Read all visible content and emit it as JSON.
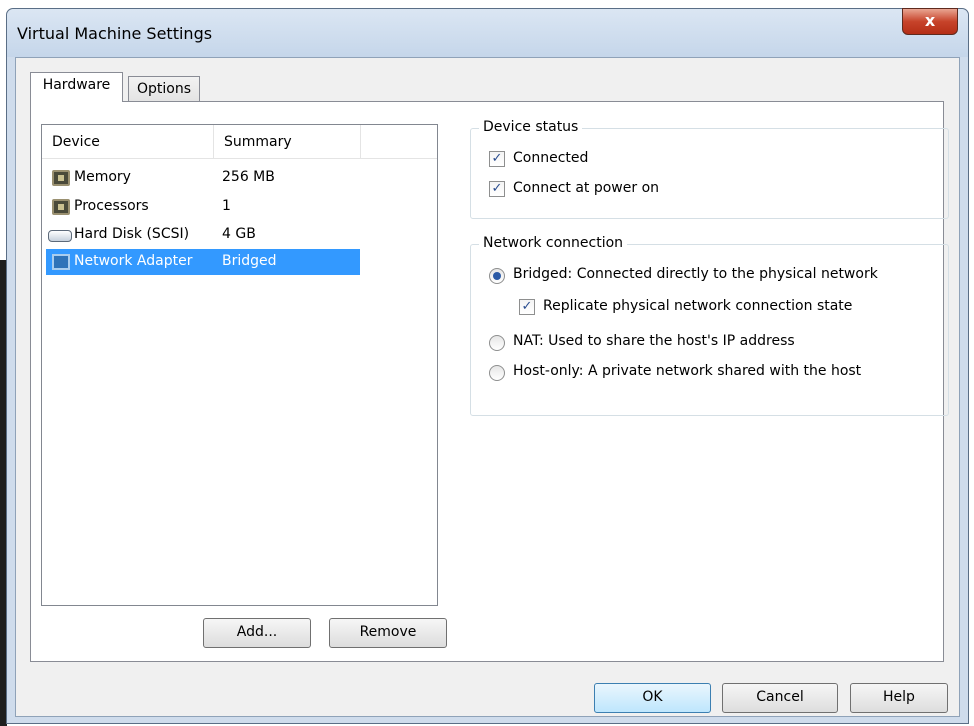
{
  "window": {
    "title": "Virtual Machine Settings",
    "close_glyph": "x"
  },
  "tabs": [
    {
      "label": "Hardware"
    },
    {
      "label": "Options"
    }
  ],
  "device_list": {
    "columns": [
      "Device",
      "Summary"
    ],
    "rows": [
      {
        "icon": "memory-icon",
        "device": "Memory",
        "summary": "256 MB"
      },
      {
        "icon": "processor-icon",
        "device": "Processors",
        "summary": "1"
      },
      {
        "icon": "hard-disk-icon",
        "device": "Hard Disk (SCSI)",
        "summary": "4 GB"
      },
      {
        "icon": "network-adapter-icon",
        "device": "Network Adapter",
        "summary": "Bridged"
      }
    ],
    "selected_index": 3
  },
  "buttons": {
    "add": "Add...",
    "remove": "Remove",
    "ok": "OK",
    "cancel": "Cancel",
    "help": "Help"
  },
  "device_status": {
    "title": "Device status",
    "connected": {
      "label": "Connected",
      "checked": true
    },
    "connect_at_power_on": {
      "label": "Connect at power on",
      "checked": true
    }
  },
  "network_connection": {
    "title": "Network connection",
    "bridged": {
      "label": "Bridged: Connected directly to the physical network",
      "selected": true
    },
    "replicate": {
      "label": "Replicate physical network connection state",
      "checked": true
    },
    "nat": {
      "label": "NAT: Used to share the host's IP address",
      "selected": false
    },
    "host_only": {
      "label": "Host-only: A private network shared with the host",
      "selected": false
    }
  },
  "colors": {
    "selection": "#3399ff",
    "title_bar": "#cfdcec",
    "close_button": "#c7432a"
  },
  "check_glyph": "✓"
}
